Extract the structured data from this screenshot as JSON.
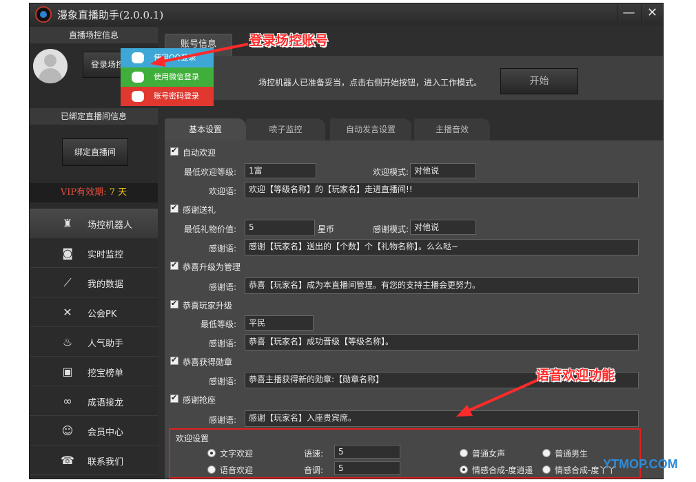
{
  "window": {
    "title": "漫象直播助手(2.0.0.1)",
    "minimize": "—",
    "close": "✕"
  },
  "sidebar": {
    "control_header": "直播场控信息",
    "login_button": "登录场控账号",
    "bound_header": "已绑定直播间信息",
    "bind_button": "绑定直播间",
    "vip_label": "VIP有效期:",
    "vip_days": "7 天",
    "nav": [
      {
        "label": "场控机器人",
        "icon": "robot-icon"
      },
      {
        "label": "实时监控",
        "icon": "camera-icon"
      },
      {
        "label": "我的数据",
        "icon": "chart-icon"
      },
      {
        "label": "公会PK",
        "icon": "swords-icon"
      },
      {
        "label": "人气助手",
        "icon": "flame-icon"
      },
      {
        "label": "挖宝榜单",
        "icon": "certificate-icon"
      },
      {
        "label": "成语接龙",
        "icon": "link-icon"
      },
      {
        "label": "会员中心",
        "icon": "user-icon"
      },
      {
        "label": "联系我们",
        "icon": "headset-icon"
      }
    ]
  },
  "login_menu": {
    "qq": "使用QQ登录",
    "wechat": "使用微信登录",
    "password": "账号密码登录"
  },
  "account": {
    "tab": "账号信息",
    "status": "场控机器人已准备妥当，点击右侧开始按钮，进入工作模式。",
    "start_button": "开始"
  },
  "tabs": [
    "基本设置",
    "喷子监控",
    "自动发言设置",
    "主播音效"
  ],
  "settings": {
    "welcome": {
      "title": "自动欢迎",
      "min_level_label": "最低欢迎等级:",
      "min_level_value": "1富",
      "mode_label": "欢迎模式:",
      "mode_value": "对他说",
      "text_label": "欢迎语:",
      "text_value": "欢迎【等级名称】的【玩家名】走进直播间!!"
    },
    "gift": {
      "title": "感谢送礼",
      "min_value_label": "最低礼物价值:",
      "min_value": "5",
      "unit": "星币",
      "mode_label": "感谢模式:",
      "mode_value": "对他说",
      "text_label": "感谢语:",
      "text_value": "感谢【玩家名】送出的【个数】个【礼物名称】。么么哒~"
    },
    "admin": {
      "title": "恭喜升级为管理",
      "text_label": "感谢语:",
      "text_value": "恭喜【玩家名】成为本直播间管理。有您的支持主播会更努力。"
    },
    "upgrade": {
      "title": "恭喜玩家升级",
      "min_level_label": "最低等级:",
      "min_level_value": "平民",
      "text_label": "感谢语:",
      "text_value": "恭喜【玩家名】成功晋级【等级名称】。"
    },
    "medal": {
      "title": "恭喜获得勋章",
      "text_label": "感谢语:",
      "text_value": "恭喜主播获得新的勋章:【勋章名称】"
    },
    "seat": {
      "title": "感谢抢座",
      "text_label": "感谢语:",
      "text_value": "感谢【玩家名】入座贵宾席。"
    },
    "voice": {
      "title": "欢迎设置",
      "text_welcome": "文字欢迎",
      "voice_welcome": "语音欢迎",
      "speed_label": "语速:",
      "speed_value": "5",
      "tone_label": "音调:",
      "tone_value": "5",
      "female": "普通女声",
      "male": "普通男生",
      "emotion_1": "情感合成-度逍遥",
      "emotion_2": "情感合成-度丫丫"
    }
  },
  "annotations": {
    "login": "登录场控账号",
    "voice": "语音欢迎功能"
  },
  "watermark": "YTMOP.COM"
}
